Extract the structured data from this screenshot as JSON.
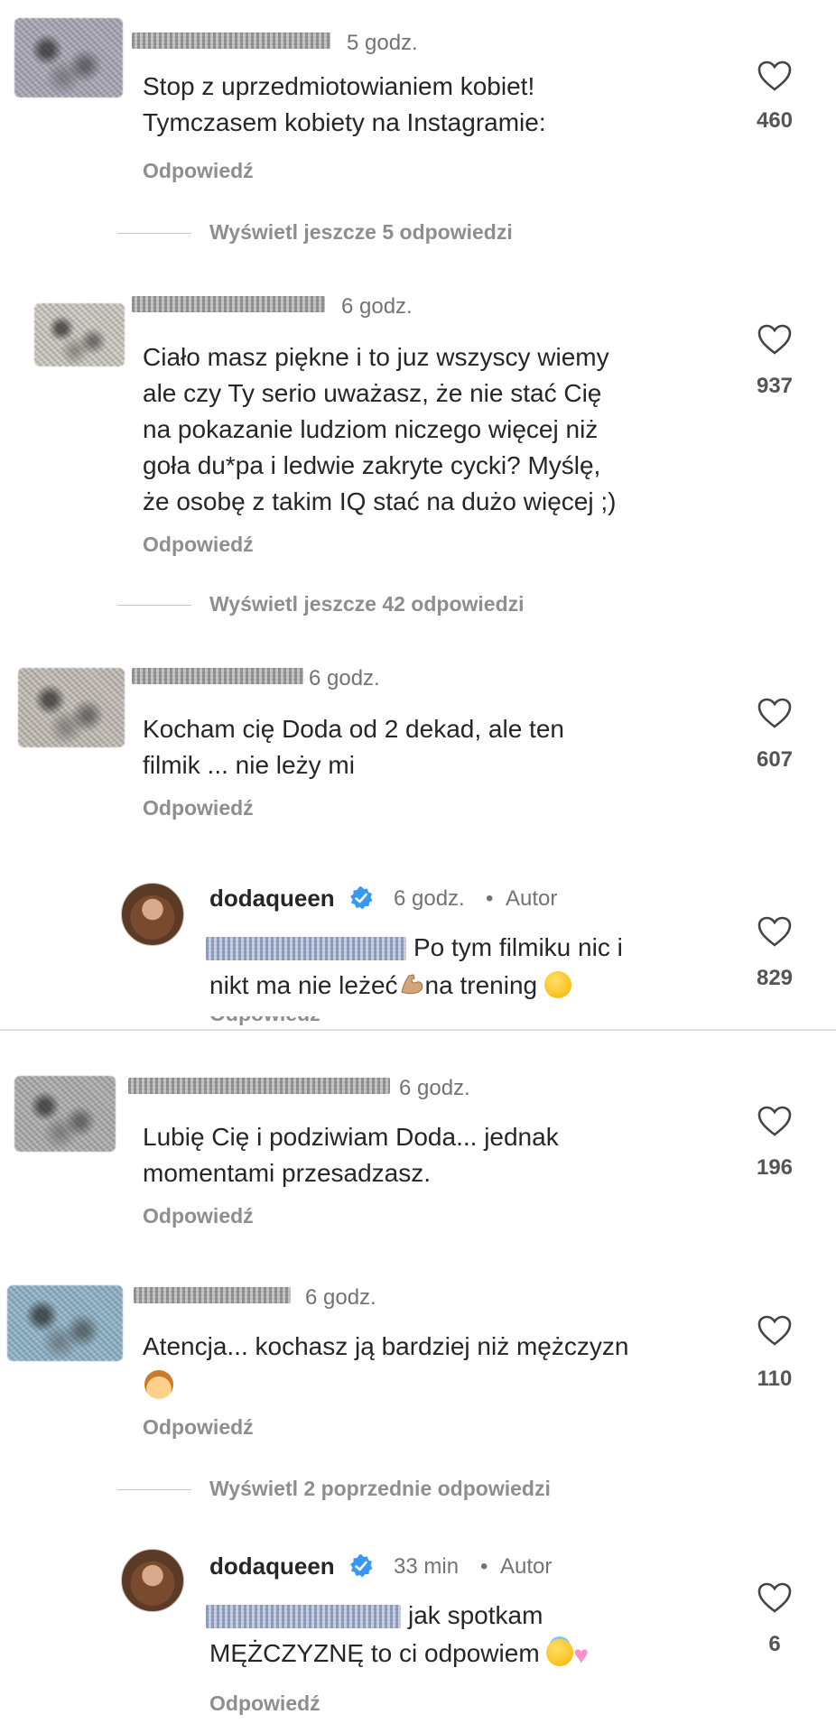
{
  "comments": [
    {
      "time": "5 godz.",
      "lines": [
        "Stop z uprzedmiotowianiem kobiet!",
        "Tymczasem kobiety na Instagramie:"
      ],
      "reply_label": "Odpowiedź",
      "likes": "460",
      "view_more": "Wyświetl jeszcze 5 odpowiedzi"
    },
    {
      "time": "6 godz.",
      "lines": [
        "Ciało masz piękne i to juz wszyscy wiemy",
        "ale czy Ty serio uważasz, że nie stać Cię",
        "na pokazanie ludziom niczego więcej niż",
        "goła du*pa i ledwie zakryte cycki? Myślę,",
        "że osobę z takim IQ stać na dużo więcej ;)"
      ],
      "reply_label": "Odpowiedź",
      "likes": "937",
      "view_more": "Wyświetl jeszcze 42 odpowiedzi"
    },
    {
      "time": "6 godz.",
      "lines": [
        "Kocham cię Doda od 2 dekad, ale ten",
        "filmik ... nie leży mi"
      ],
      "reply_label": "Odpowiedź",
      "likes": "607",
      "reply": {
        "username": "dodaqueen",
        "time": "6 godz.",
        "author": "Autor",
        "line1_tail": "Po tym filmiku nic i",
        "line2_a": "nikt ma nie leżeć",
        "line2_b": "na trening",
        "likes": "829"
      }
    },
    {
      "time": "6 godz.",
      "lines": [
        "Lubię Cię i podziwiam Doda... jednak",
        "momentami przesadzasz."
      ],
      "reply_label": "Odpowiedź",
      "likes": "196"
    },
    {
      "time": "6 godz.",
      "lines": [
        "Atencja... kochasz ją bardziej niż mężczyzn"
      ],
      "reply_label": "Odpowiedź",
      "likes": "110",
      "view_prev": "Wyświetl 2 poprzednie odpowiedzi",
      "reply": {
        "username": "dodaqueen",
        "time": "33 min",
        "author": "Autor",
        "line1_tail": "jak spotkam",
        "line2": "MĘŻCZYZNĘ to ci odpowiem",
        "reply_label": "Odpowiedź",
        "likes": "6"
      }
    }
  ],
  "cut_text": "Odpowiedź",
  "colors": {
    "text": "#262626",
    "muted": "#8e8e8e",
    "verified": "#3897f0"
  },
  "icons": [
    "heart-icon",
    "verified-badge-icon",
    "muscle-emoji",
    "winking-face-emoji",
    "boy-emoji",
    "halo-face-emoji",
    "pink-heart-emoji"
  ]
}
